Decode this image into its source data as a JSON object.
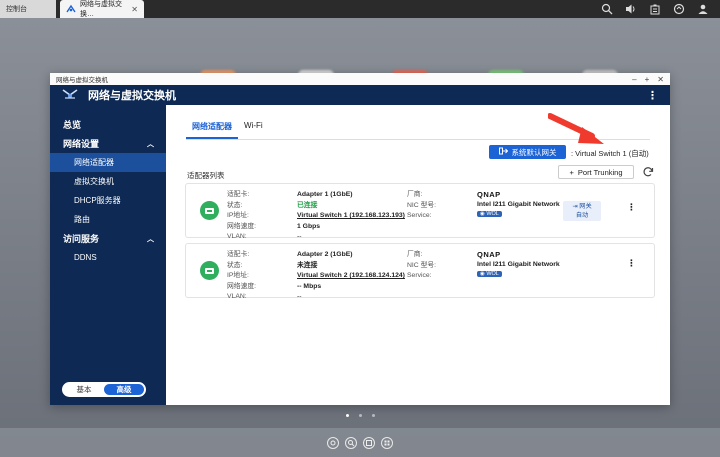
{
  "browser": {
    "tabs": [
      {
        "label": "控制台"
      },
      {
        "label": "网络与虚拟交换…"
      }
    ]
  },
  "window": {
    "titlebar": "网络与虚拟交换机",
    "app_title": "网络与虚拟交换机"
  },
  "sidebar": {
    "overview": "总览",
    "network_settings": "网络设置",
    "items": [
      {
        "label": "网络适配器"
      },
      {
        "label": "虚拟交换机"
      },
      {
        "label": "DHCP服务器"
      },
      {
        "label": "路由"
      }
    ],
    "access_services": "访问服务",
    "access_items": [
      {
        "label": "DDNS"
      }
    ],
    "mode_basic": "基本",
    "mode_advanced": "高级"
  },
  "content": {
    "tabs": [
      {
        "label": "网络适配器"
      },
      {
        "label": "Wi-Fi"
      }
    ],
    "gateway_button": "系统默认网关",
    "gateway_value": ": Virtual Switch 1 (自动)",
    "list_title": "适配器列表",
    "port_trunking": "Port Trunking",
    "labels": {
      "adapter": "适配卡:",
      "status": "状态:",
      "ip": "IP地址:",
      "speed": "网络速度:",
      "vlan": "VLAN:",
      "vendor": "厂商:",
      "nic_model": "NIC 型号:",
      "service": "Service:"
    },
    "adapters": [
      {
        "name": "Adapter 1 (1GbE)",
        "status": "已连接",
        "ip": "Virtual Switch 1 (192.168.123.193)",
        "speed": "1 Gbps",
        "vlan": "--",
        "vendor": "QNAP",
        "model": "Intel I211 Gigabit Network",
        "wol": "WOL",
        "gateway_badge": "网关",
        "gateway_mode": "自动"
      },
      {
        "name": "Adapter 2 (1GbE)",
        "status": "未连接",
        "ip": "Virtual Switch 2 (192.168.124.124)",
        "speed": "-- Mbps",
        "vlan": "--",
        "vendor": "QNAP",
        "model": "Intel I211 Gigabit Network",
        "wol": "WOL"
      }
    ]
  },
  "colors": {
    "sidebar_bg": "#0e2a54",
    "accent": "#1c63d6",
    "connected": "#1f9d47",
    "nic_icon": "#2fae5e",
    "arrow": "#f03a2e"
  }
}
